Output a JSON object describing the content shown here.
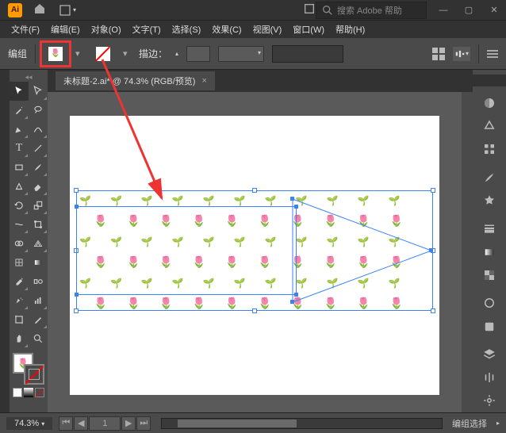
{
  "app": {
    "icon_text": "Ai"
  },
  "titlebar": {
    "search_placeholder": "搜索 Adobe 帮助"
  },
  "menus": [
    "文件(F)",
    "编辑(E)",
    "对象(O)",
    "文字(T)",
    "选择(S)",
    "效果(C)",
    "视图(V)",
    "窗口(W)",
    "帮助(H)"
  ],
  "options": {
    "mode_label": "编组",
    "stroke_label": "描边："
  },
  "tab": {
    "title": "未标题-2.ai* @ 74.3% (RGB/预览)"
  },
  "statusbar": {
    "zoom": "74.3%",
    "artboard_current": "1",
    "selection_label": "编组选择"
  },
  "tools": {
    "row1": [
      "selection-tool",
      "direct-selection-tool"
    ],
    "row2": [
      "magic-wand-tool",
      "lasso-tool"
    ],
    "row3": [
      "pen-tool",
      "curvature-tool"
    ],
    "row4": [
      "type-tool",
      "line-segment-tool"
    ],
    "row5": [
      "rectangle-tool",
      "paintbrush-tool"
    ],
    "row6": [
      "shaper-tool",
      "eraser-tool"
    ],
    "row7": [
      "rotate-tool",
      "scale-tool"
    ],
    "row8": [
      "width-tool",
      "free-transform-tool"
    ],
    "row9": [
      "shape-builder-tool",
      "perspective-grid-tool"
    ],
    "row10": [
      "mesh-tool",
      "gradient-tool"
    ],
    "row11": [
      "eyedropper-tool",
      "blend-tool"
    ],
    "row12": [
      "symbol-sprayer-tool",
      "column-graph-tool"
    ],
    "row13": [
      "artboard-tool",
      "slice-tool"
    ],
    "row14": [
      "hand-tool",
      "zoom-tool"
    ]
  },
  "right_panels": [
    "color-panel",
    "color-guide-panel",
    "swatches-panel",
    "brushes-panel",
    "symbols-panel",
    "stroke-panel",
    "gradient-panel",
    "transparency-panel",
    "appearance-panel",
    "graphic-styles-panel",
    "layers-panel",
    "asset-export-panel",
    "artboards-panel",
    "libraries-panel",
    "properties-panel"
  ]
}
